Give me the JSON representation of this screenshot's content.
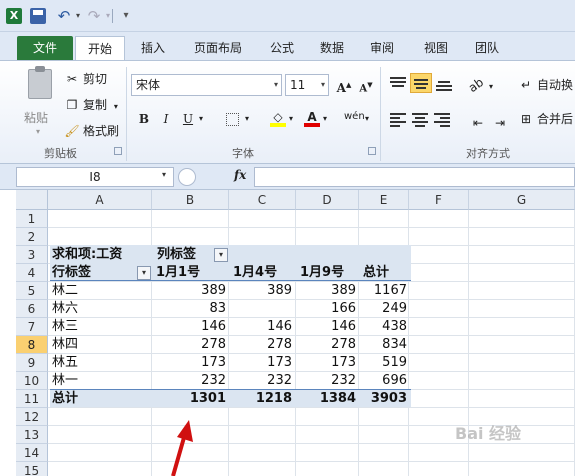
{
  "qat": {
    "logo": "X",
    "undo_glyph": "↶",
    "redo_glyph": "↷",
    "dropdown_glyph": "▾",
    "customize_glyph": "▾"
  },
  "tabs": [
    {
      "label": "文件"
    },
    {
      "label": "开始"
    },
    {
      "label": "插入"
    },
    {
      "label": "页面布局"
    },
    {
      "label": "公式"
    },
    {
      "label": "数据"
    },
    {
      "label": "审阅"
    },
    {
      "label": "视图"
    },
    {
      "label": "团队"
    }
  ],
  "ribbon": {
    "clipboard": {
      "paste": "粘贴",
      "cut": "剪切",
      "copy": "复制",
      "painter": "格式刷",
      "group_label": "剪贴板"
    },
    "font": {
      "name": "宋体",
      "size": "11",
      "grow": "A",
      "shrink": "A",
      "bold": "B",
      "italic": "I",
      "underline": "U",
      "font_color": "A",
      "phonetic": "wén",
      "group_label": "字体"
    },
    "alignment": {
      "wrap_text": "自动换",
      "merge": "合并后",
      "group_label": "对齐方式"
    }
  },
  "formula_bar": {
    "name_box": "I8",
    "fx": "fx",
    "value": ""
  },
  "grid": {
    "columns": [
      "A",
      "B",
      "C",
      "D",
      "E",
      "F",
      "G"
    ],
    "rows": [
      "1",
      "2",
      "3",
      "4",
      "5",
      "6",
      "7",
      "8",
      "9",
      "10",
      "11",
      "12",
      "13",
      "14",
      "15"
    ],
    "active_row": "8"
  },
  "pivot": {
    "title": "求和项:工资",
    "col_label_header": "列标签",
    "row_label_header": "行标签",
    "col_headers": [
      "1月1号",
      "1月4号",
      "1月9号",
      "总计"
    ],
    "rows": [
      {
        "name": "林二",
        "v1": "389",
        "v2": "389",
        "v3": "389",
        "total": "1167"
      },
      {
        "name": "林六",
        "v1": "83",
        "v2": "",
        "v3": "166",
        "total": "249"
      },
      {
        "name": "林三",
        "v1": "146",
        "v2": "146",
        "v3": "146",
        "total": "438"
      },
      {
        "name": "林四",
        "v1": "278",
        "v2": "278",
        "v3": "278",
        "total": "834"
      },
      {
        "name": "林五",
        "v1": "173",
        "v2": "173",
        "v3": "173",
        "total": "519"
      },
      {
        "name": "林一",
        "v1": "232",
        "v2": "232",
        "v3": "232",
        "total": "696"
      }
    ],
    "total_row": {
      "name": "总计",
      "v1": "1301",
      "v2": "1218",
      "v3": "1384",
      "total": "3903"
    }
  },
  "annotation": {
    "arrow_color": "#d01010"
  },
  "watermark": "Bai 经验",
  "colors": {
    "file_tab": "#2a7a3b",
    "pivot_header_fill": "#dbe5f1",
    "active_row_header": "#fad071",
    "highlight_button": "#fbd66a"
  }
}
